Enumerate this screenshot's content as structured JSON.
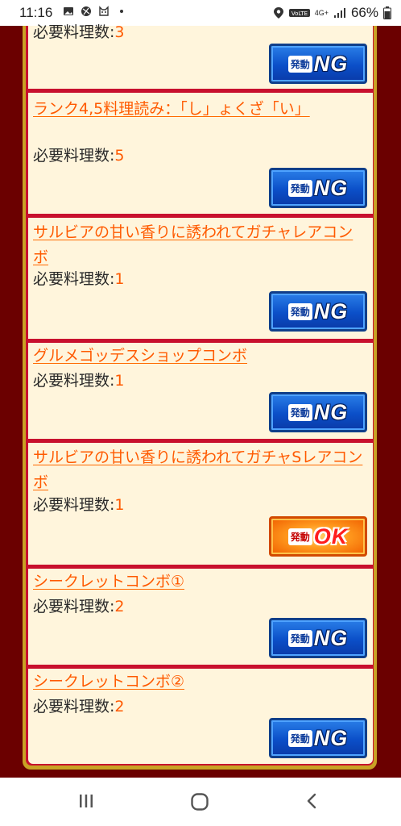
{
  "status_bar": {
    "time": "11:16",
    "network_label": "4G+",
    "battery": "66%",
    "left_icons": [
      "image-icon",
      "soccer-ball-icon",
      "cat-icon",
      "dot-icon"
    ],
    "right_icons": [
      "location-icon",
      "volte-icon",
      "signal-icon",
      "battery-icon"
    ]
  },
  "cards": [
    {
      "title": "",
      "req_label": "必要料理数:",
      "req_value": "3",
      "status": "NG"
    },
    {
      "title": "ランク4,5料理読み：「し」ょくざ「い」",
      "req_label": "必要料理数:",
      "req_value": "5",
      "status": "NG"
    },
    {
      "title": "サルビアの甘い香りに誘われてガチャレアコンボ",
      "req_label": "必要料理数:",
      "req_value": "1",
      "status": "NG"
    },
    {
      "title": "グルメゴッデスショップコンボ",
      "req_label": "必要料理数:",
      "req_value": "1",
      "status": "NG"
    },
    {
      "title": "サルビアの甘い香りに誘われてガチャSレアコンボ",
      "req_label": "必要料理数:",
      "req_value": "1",
      "status": "OK"
    },
    {
      "title": "シークレットコンボ①",
      "req_label": "必要料理数:",
      "req_value": "2",
      "status": "NG"
    },
    {
      "title": "シークレットコンボ②",
      "req_label": "必要料理数:",
      "req_value": "2",
      "status": "NG"
    }
  ],
  "button": {
    "kanji": "発動",
    "ng_word": "NG",
    "ok_word": "OK"
  },
  "nav_bar": {
    "recents_icon": "recents-icon",
    "home_icon": "home-icon",
    "back_icon": "back-icon"
  },
  "colors": {
    "page_bg": "#6b0000",
    "card_bg": "#fff5dc",
    "separator": "#c8102e",
    "gold_frame": "#c9a224",
    "title_orange": "#ff5a00",
    "ng_blue": "#0b4fc8",
    "ok_orange": "#ff9a1e"
  }
}
